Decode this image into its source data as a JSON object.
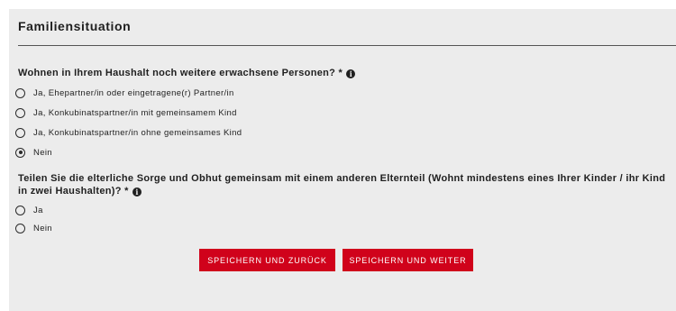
{
  "section": {
    "title": "Familiensituation"
  },
  "question1": {
    "text": "Wohnen in Ihrem Haushalt noch weitere erwachsene Personen? *",
    "info_icon": "info-circle-icon",
    "options": [
      {
        "label": "Ja, Ehepartner/in oder eingetragene(r) Partner/in",
        "checked": false
      },
      {
        "label": "Ja, Konkubinatspartner/in mit gemeinsamem Kind",
        "checked": false
      },
      {
        "label": "Ja, Konkubinatspartner/in ohne gemeinsames Kind",
        "checked": false
      },
      {
        "label": "Nein",
        "checked": true
      }
    ]
  },
  "question2": {
    "text": "Teilen Sie die elterliche Sorge und Obhut gemeinsam mit einem anderen Elternteil (Wohnt mindestens eines Ihrer Kinder / ihr Kind in zwei Haushalten)? *",
    "info_icon": "info-circle-icon",
    "options": [
      {
        "label": "Ja",
        "checked": false
      },
      {
        "label": "Nein",
        "checked": false
      }
    ]
  },
  "buttons": {
    "save_back": "SPEICHERN UND ZURÜCK",
    "save_next": "SPEICHERN UND WEITER"
  },
  "colors": {
    "panel_background": "#ececec",
    "button_red": "#d0021b",
    "text": "#1f1f1f"
  }
}
